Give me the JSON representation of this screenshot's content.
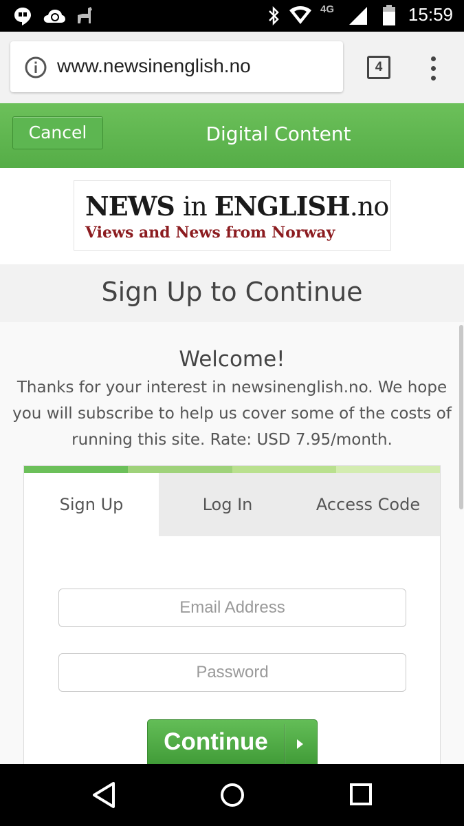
{
  "status_bar": {
    "time": "15:59",
    "network_type": "4G",
    "icons": [
      "hangouts-icon",
      "cloud-sync-icon",
      "android-icon",
      "bluetooth-icon",
      "wifi-icon",
      "signal-icon",
      "battery-icon"
    ]
  },
  "browser": {
    "url": "www.newsinenglish.no",
    "tab_count": "4"
  },
  "header": {
    "cancel_label": "Cancel",
    "title": "Digital Content",
    "accent_color": "#5cb553"
  },
  "logo": {
    "line1_news": "NEWS ",
    "line1_in": "in ",
    "line1_english": "ENGLISH",
    "line1_tld": ".no",
    "tagline": "Views and News from Norway"
  },
  "page": {
    "title": "Sign Up to Continue",
    "welcome": "Welcome!",
    "intro": "Thanks for your interest in newsinenglish.no. We hope you will subscribe to help us cover some of the costs of running this site. Rate: USD 7.95/month."
  },
  "progress": {
    "step_colors": [
      "#6cc05a",
      "#9fd27a",
      "#b9e08e",
      "#d3ecb0"
    ]
  },
  "tabs": {
    "signup": "Sign Up",
    "login": "Log In",
    "access_code": "Access Code"
  },
  "form": {
    "email_placeholder": "Email Address",
    "password_placeholder": "Password",
    "continue_label": "Continue"
  }
}
